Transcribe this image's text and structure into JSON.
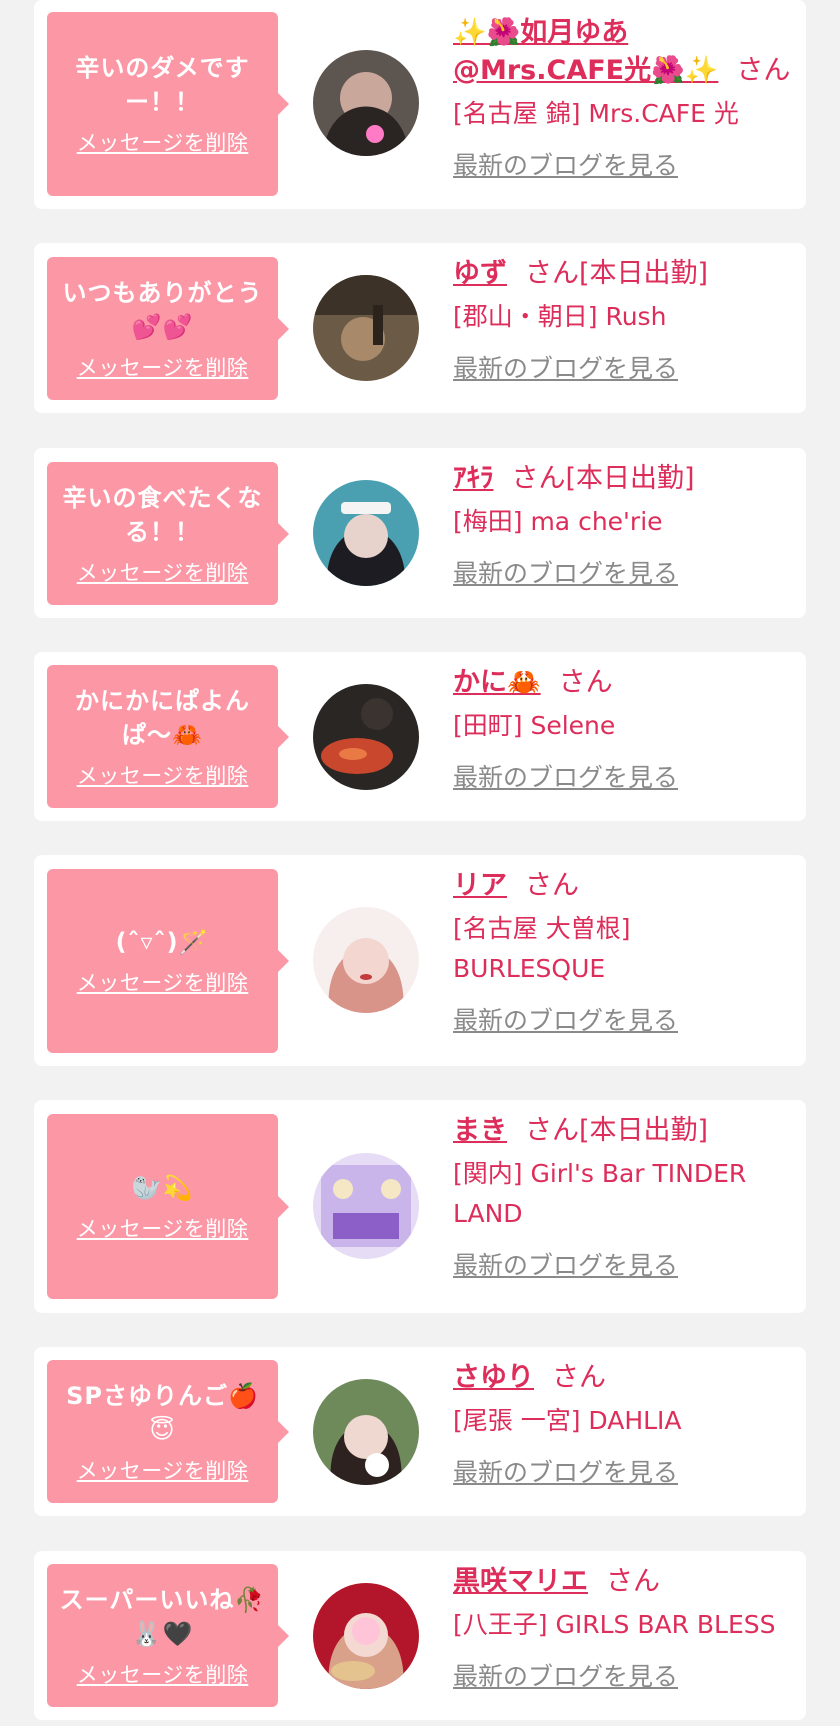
{
  "delete_label": "メッセージを削除",
  "blog_label": "最新のブログを見る",
  "san_label": "さん",
  "items": [
    {
      "message": "辛いのダメですー！！",
      "name": "✨🌺如月ゆあ@Mrs.CAFE光🌺✨",
      "status": "",
      "shop": "[名古屋 錦] Mrs.CAFE 光"
    },
    {
      "message": "いつもありがとう💕💕",
      "name": "ゆず",
      "status": "[本日出勤]",
      "shop": "[郡山・朝日] Rush"
    },
    {
      "message": "辛いの食べたくなる！！",
      "name": "ｱｷﾗ",
      "status": "[本日出勤]",
      "shop": "[梅田] ma che'rie"
    },
    {
      "message": "かにかにぱよんぱ〜🦀",
      "name": "かに🦀",
      "status": "",
      "shop": "[田町] Selene"
    },
    {
      "message": "(ˆ▿ˆ)🪄",
      "name": "リア",
      "status": "",
      "shop": "[名古屋 大曽根] BURLESQUE"
    },
    {
      "message": "🦭💫",
      "name": "まき",
      "status": "[本日出勤]",
      "shop": "[関内] Girl's Bar TINDER LAND"
    },
    {
      "message": "SPさゆりんご🍎😇",
      "name": "さゆり",
      "status": "",
      "shop": "[尾張 一宮] DAHLIA"
    },
    {
      "message": "スーパーいいね🥀🐰🖤",
      "name": "黒咲マリエ",
      "status": "",
      "shop": "[八王子] GIRLS BAR BLESS"
    }
  ],
  "colors": {
    "background": "#f2f2f2",
    "card": "#ffffff",
    "bubble": "#fc97a6",
    "accent": "#dd2d5a",
    "link_gray": "#8a8a8a"
  }
}
